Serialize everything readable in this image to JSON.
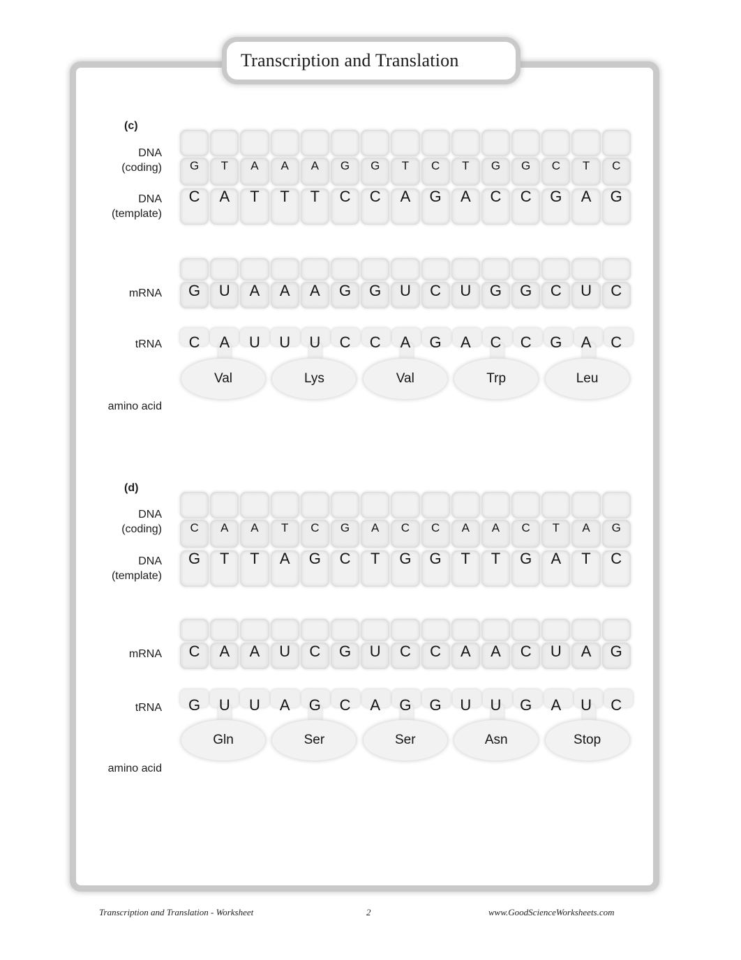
{
  "title": "Transcription and Translation",
  "labels": {
    "dna_coding": [
      "DNA",
      "(coding)"
    ],
    "dna_template": [
      "DNA",
      "(template)"
    ],
    "mrna": "mRNA",
    "trna": "tRNA",
    "amino_acid": "amino acid"
  },
  "sections": [
    {
      "letter": "(c)",
      "dna_coding": [
        "G",
        "T",
        "A",
        "A",
        "A",
        "G",
        "G",
        "T",
        "C",
        "T",
        "G",
        "G",
        "C",
        "T",
        "C"
      ],
      "dna_template": [
        "C",
        "A",
        "T",
        "T",
        "T",
        "C",
        "C",
        "A",
        "G",
        "A",
        "C",
        "C",
        "G",
        "A",
        "G"
      ],
      "mrna": [
        "G",
        "U",
        "A",
        "A",
        "A",
        "G",
        "G",
        "U",
        "C",
        "U",
        "G",
        "G",
        "C",
        "U",
        "C"
      ],
      "trna": [
        "C",
        "A",
        "U",
        "U",
        "U",
        "C",
        "C",
        "A",
        "G",
        "A",
        "C",
        "C",
        "G",
        "A",
        "C"
      ],
      "amino_acids": [
        "Val",
        "Lys",
        "Val",
        "Trp",
        "Leu"
      ]
    },
    {
      "letter": "(d)",
      "dna_coding": [
        "C",
        "A",
        "A",
        "T",
        "C",
        "G",
        "A",
        "C",
        "C",
        "A",
        "A",
        "C",
        "T",
        "A",
        "G"
      ],
      "dna_template": [
        "G",
        "T",
        "T",
        "A",
        "G",
        "C",
        "T",
        "G",
        "G",
        "T",
        "T",
        "G",
        "A",
        "T",
        "C"
      ],
      "mrna": [
        "C",
        "A",
        "A",
        "U",
        "C",
        "G",
        "U",
        "C",
        "C",
        "A",
        "A",
        "C",
        "U",
        "A",
        "G"
      ],
      "trna": [
        "G",
        "U",
        "U",
        "A",
        "G",
        "C",
        "A",
        "G",
        "G",
        "U",
        "U",
        "G",
        "A",
        "U",
        "C"
      ],
      "amino_acids": [
        "Gln",
        "Ser",
        "Ser",
        "Asn",
        "Stop"
      ]
    }
  ],
  "footer": {
    "left": "Transcription and Translation - Worksheet",
    "page": "2",
    "right": "www.GoodScienceWorksheets.com"
  },
  "colors": {
    "frame": "#c9c9c9",
    "block": "#f1f1f1",
    "text": "#141414"
  }
}
